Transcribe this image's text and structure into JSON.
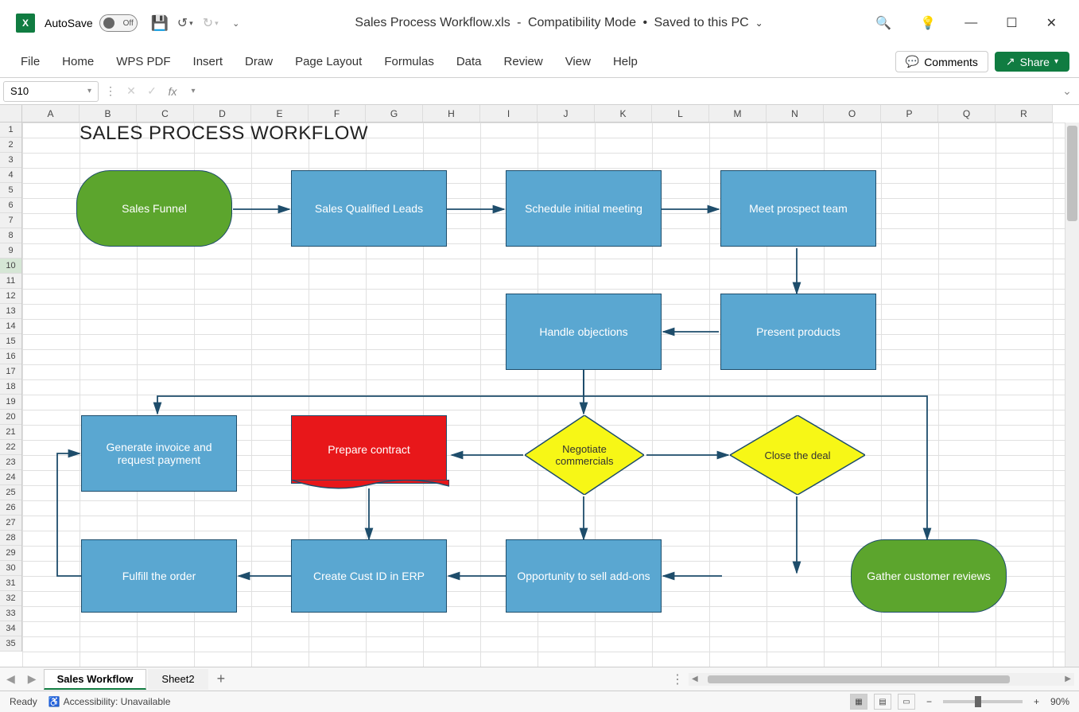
{
  "titlebar": {
    "autosave_label": "AutoSave",
    "autosave_state": "Off",
    "filename": "Sales Process Workflow.xls",
    "mode": "Compatibility Mode",
    "saved": "Saved to this PC"
  },
  "ribbon": {
    "tabs": [
      "File",
      "Home",
      "WPS PDF",
      "Insert",
      "Draw",
      "Page Layout",
      "Formulas",
      "Data",
      "Review",
      "View",
      "Help"
    ],
    "comments": "Comments",
    "share": "Share"
  },
  "name_box": "S10",
  "formula": "",
  "columns": [
    "A",
    "B",
    "C",
    "D",
    "E",
    "F",
    "G",
    "H",
    "I",
    "J",
    "K",
    "L",
    "M",
    "N",
    "O",
    "P",
    "Q",
    "R"
  ],
  "row_count": 35,
  "selected_row": 10,
  "worksheet_title": "SALES PROCESS WORKFLOW",
  "shapes": {
    "sales_funnel": "Sales Funnel",
    "sql": "Sales Qualified Leads",
    "schedule": "Schedule initial meeting",
    "meet": "Meet prospect team",
    "handle": "Handle objections",
    "present": "Present products",
    "negotiate": "Negotiate commercials",
    "close": "Close the deal",
    "prepare": "Prepare contract",
    "invoice": "Generate invoice and request payment",
    "create_cust": "Create Cust ID in ERP",
    "addons": "Opportunity to sell add-ons",
    "gather": "Gather customer reviews",
    "fulfill": "Fulfill the order"
  },
  "sheets": {
    "tabs": [
      "Sales Workflow",
      "Sheet2"
    ],
    "active": 0
  },
  "status": {
    "ready": "Ready",
    "accessibility": "Accessibility: Unavailable",
    "zoom": "90%"
  }
}
